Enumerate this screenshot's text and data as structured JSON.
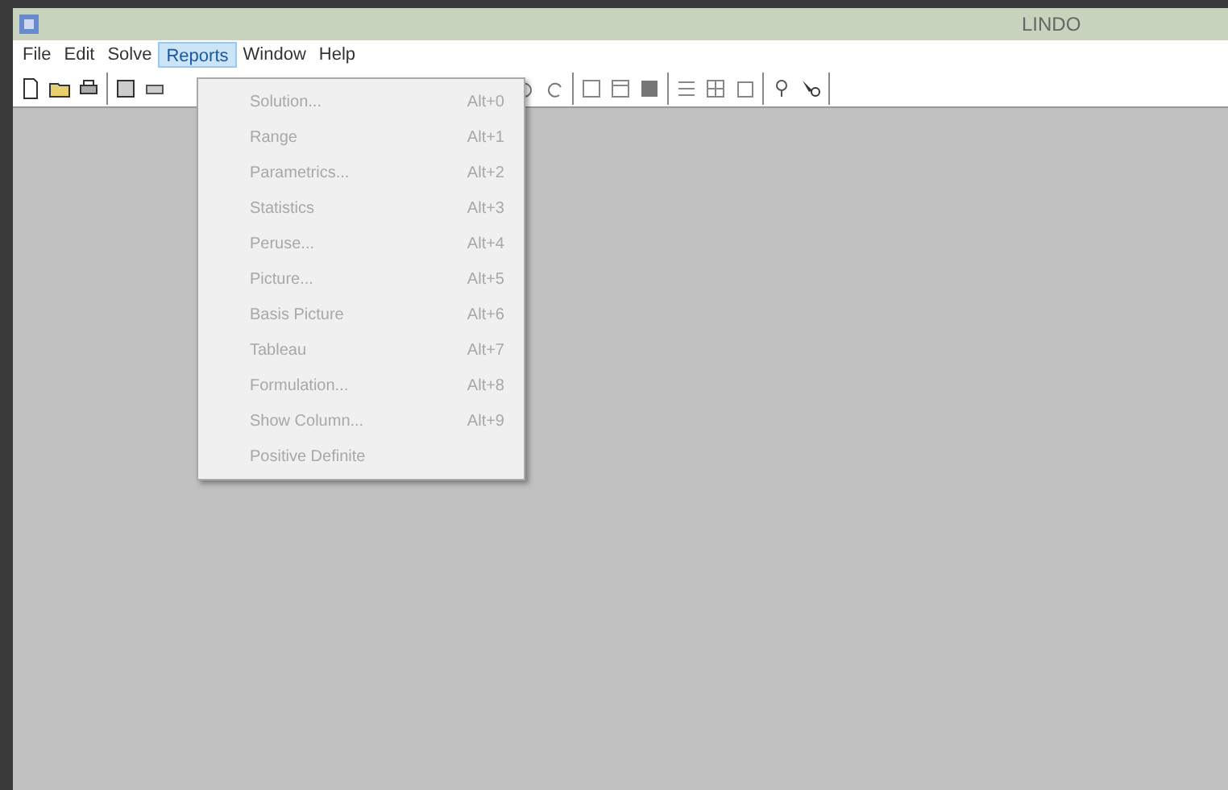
{
  "window": {
    "title": "LINDO"
  },
  "menu_bar": [
    {
      "label": "File",
      "selected": false
    },
    {
      "label": "Edit",
      "selected": false
    },
    {
      "label": "Solve",
      "selected": false
    },
    {
      "label": "Reports",
      "selected": true
    },
    {
      "label": "Window",
      "selected": false
    },
    {
      "label": "Help",
      "selected": false
    }
  ],
  "reports_menu": [
    {
      "label": "Solution...",
      "shortcut": "Alt+0",
      "disabled": true
    },
    {
      "label": "Range",
      "shortcut": "Alt+1",
      "disabled": true
    },
    {
      "label": "Parametrics...",
      "shortcut": "Alt+2",
      "disabled": true
    },
    {
      "label": "Statistics",
      "shortcut": "Alt+3",
      "disabled": true
    },
    {
      "label": "Peruse...",
      "shortcut": "Alt+4",
      "disabled": true
    },
    {
      "label": "Picture...",
      "shortcut": "Alt+5",
      "disabled": true
    },
    {
      "label": "Basis Picture",
      "shortcut": "Alt+6",
      "disabled": true
    },
    {
      "label": "Tableau",
      "shortcut": "Alt+7",
      "disabled": true
    },
    {
      "label": "Formulation...",
      "shortcut": "Alt+8",
      "disabled": true
    },
    {
      "label": "Show Column...",
      "shortcut": "Alt+9",
      "disabled": true
    },
    {
      "label": "Positive Definite",
      "disabled": true
    }
  ]
}
